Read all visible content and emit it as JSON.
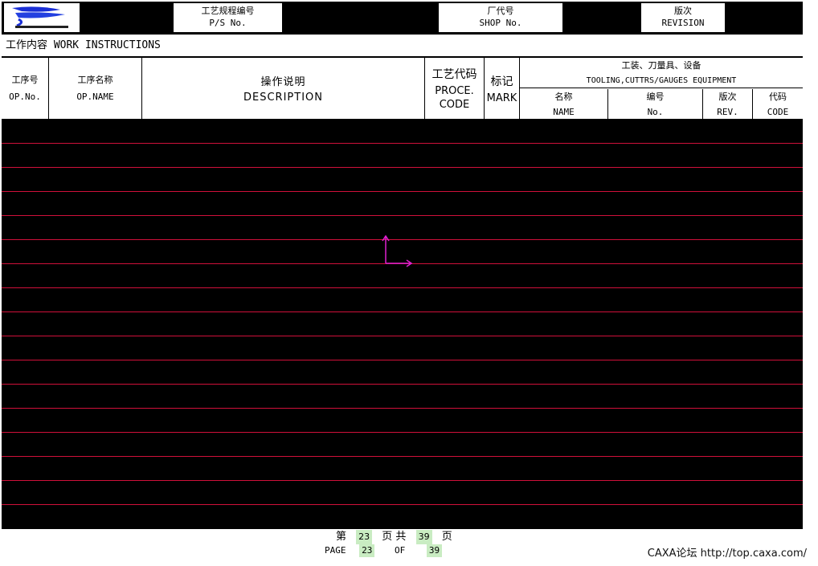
{
  "header": {
    "logo": "company-logo",
    "ps_no": {
      "cn": "工艺规程编号",
      "en": "P/S No."
    },
    "shop_no": {
      "cn": "厂代号",
      "en": "SHOP No."
    },
    "revision": {
      "cn": "版次",
      "en": "REVISION"
    }
  },
  "section_title": "工作内容 WORK INSTRUCTIONS",
  "columns": {
    "op_no": {
      "cn": "工序号",
      "en": "OP.No."
    },
    "op_name": {
      "cn": "工序名称",
      "en": "OP.NAME"
    },
    "description": {
      "cn": "操作说明",
      "en": "DESCRIPTION"
    },
    "proc_code": {
      "cn": "工艺代码",
      "en1": "PROCE.",
      "en2": "CODE"
    },
    "mark": {
      "cn": "标记",
      "en": "MARK"
    },
    "tooling": {
      "cn": "工装、刀量具、设备",
      "en": "TOOLING,CUTTRS/GAUGES EQUIPMENT",
      "sub": [
        {
          "cn": "名称",
          "en": "NAME"
        },
        {
          "cn": "编号",
          "en": "No."
        },
        {
          "cn": "版次",
          "en": "REV."
        },
        {
          "cn": "代码",
          "en": "CODE"
        }
      ]
    }
  },
  "colors": {
    "rule_line": "#d0103a",
    "axis": "#e020d0",
    "page_highlight": "#c9ecc2"
  },
  "footer": {
    "cn_prefix": "第",
    "page": "23",
    "cn_mid": "页 共",
    "total": "39",
    "cn_suffix": "页",
    "en_prefix": "PAGE",
    "en_mid": "OF"
  },
  "watermark": "CAXA论坛 http://top.caxa.com/"
}
